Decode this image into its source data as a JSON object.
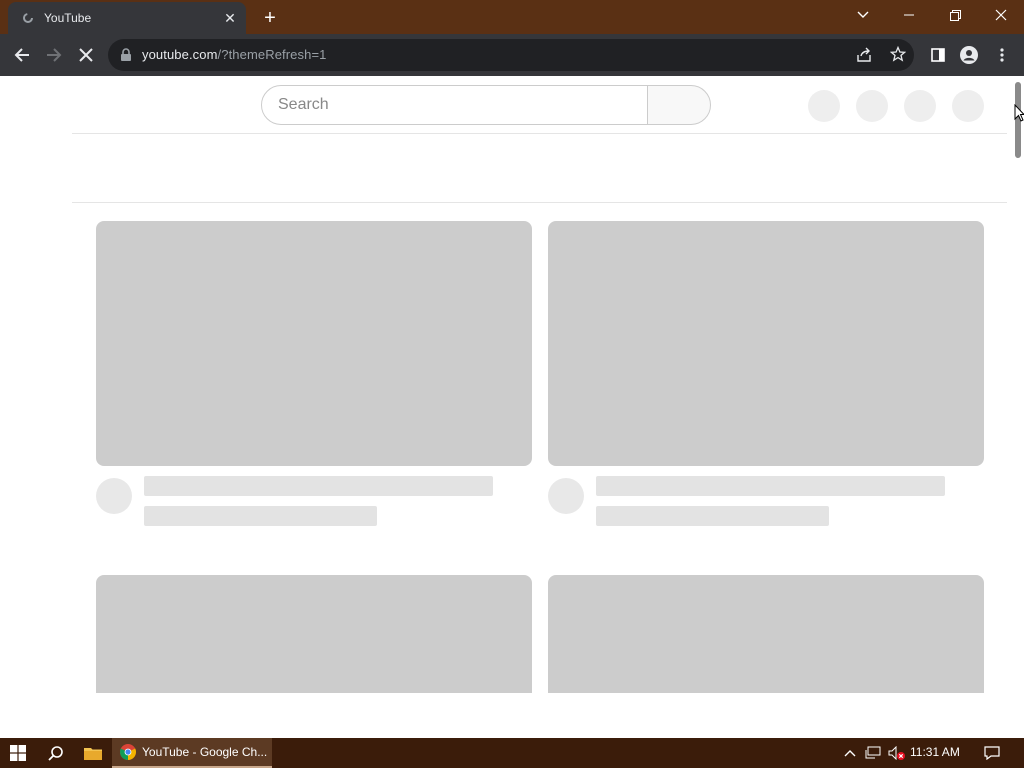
{
  "browser": {
    "tab": {
      "title": "YouTube",
      "close_glyph": "✕"
    },
    "new_tab_glyph": "+",
    "url": {
      "host": "youtube.com",
      "path": "/?themeRefresh=1"
    }
  },
  "youtube": {
    "search": {
      "placeholder": "Search",
      "value": ""
    }
  },
  "taskbar": {
    "app_label": "YouTube - Google Ch...",
    "clock": "11:31 AM"
  },
  "colors": {
    "tab_strip": "#5a3014",
    "toolbar": "#35363a",
    "taskbar": "#3b1c0a",
    "placeholder": "#cccccc"
  }
}
